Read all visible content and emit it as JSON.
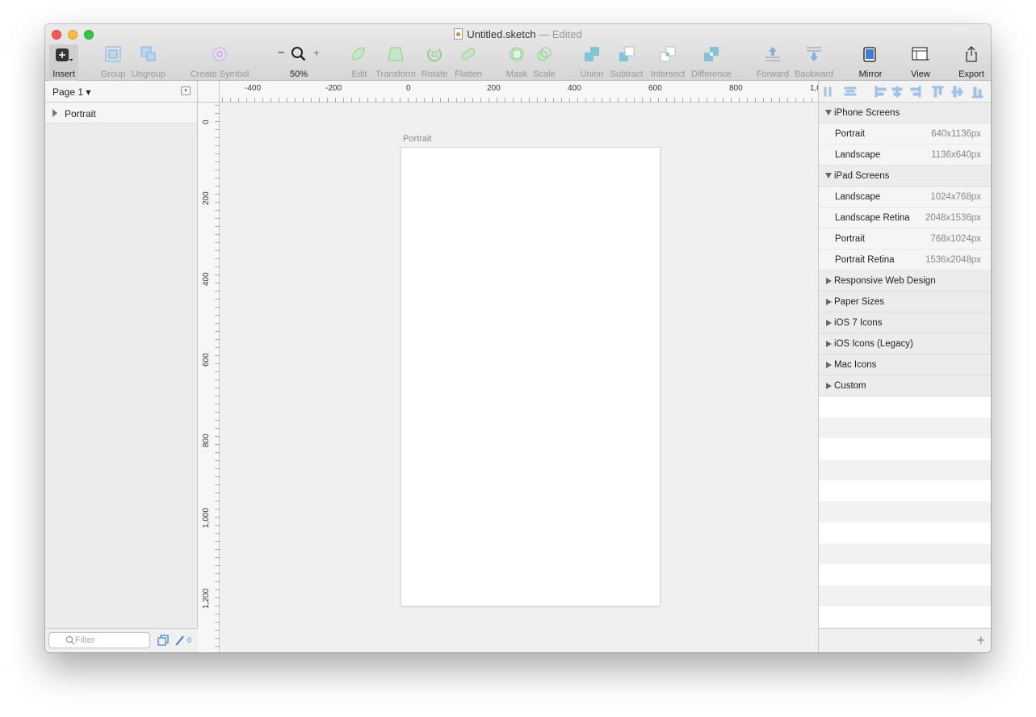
{
  "window": {
    "title": "Untitled.sketch",
    "status": "— Edited"
  },
  "toolbar": [
    {
      "name": "insert-button",
      "label": "Insert",
      "icon": "insert-plus-icon"
    },
    {
      "name": "group-button",
      "label": "Group",
      "icon": "group-icon"
    },
    {
      "name": "ungroup-button",
      "label": "Ungroup",
      "icon": "ungroup-icon"
    },
    {
      "name": "create-symbol-button",
      "label": "Create Symbol",
      "icon": "symbol-icon"
    },
    {
      "name": "zoom-control",
      "label": "50%",
      "icon": "magnifier-icon"
    },
    {
      "name": "edit-button",
      "label": "Edit",
      "icon": "edit-icon"
    },
    {
      "name": "transform-button",
      "label": "Transform",
      "icon": "transform-icon"
    },
    {
      "name": "rotate-button",
      "label": "Rotate",
      "icon": "rotate-icon"
    },
    {
      "name": "flatten-button",
      "label": "Flatten",
      "icon": "flatten-icon"
    },
    {
      "name": "mask-button",
      "label": "Mask",
      "icon": "mask-icon"
    },
    {
      "name": "scale-button",
      "label": "Scale",
      "icon": "scale-icon"
    },
    {
      "name": "union-button",
      "label": "Union",
      "icon": "union-icon"
    },
    {
      "name": "subtract-button",
      "label": "Subtract",
      "icon": "subtract-icon"
    },
    {
      "name": "intersect-button",
      "label": "Intersect",
      "icon": "intersect-icon"
    },
    {
      "name": "difference-button",
      "label": "Difference",
      "icon": "difference-icon"
    },
    {
      "name": "forward-button",
      "label": "Forward",
      "icon": "forward-icon"
    },
    {
      "name": "backward-button",
      "label": "Backward",
      "icon": "backward-icon"
    },
    {
      "name": "mirror-button",
      "label": "Mirror",
      "icon": "mirror-icon"
    },
    {
      "name": "view-button",
      "label": "View",
      "icon": "view-icon"
    },
    {
      "name": "export-button",
      "label": "Export",
      "icon": "export-icon"
    }
  ],
  "zoom": {
    "minus": "−",
    "plus": "+"
  },
  "sidebar": {
    "page_label": "Page 1 ▾",
    "layers": [
      {
        "label": "Portrait"
      }
    ],
    "filter_placeholder": "Filter",
    "count": "0"
  },
  "rulers": {
    "horizontal": [
      "-400",
      "-200",
      "0",
      "200",
      "400",
      "600",
      "800",
      "1,0"
    ],
    "vertical": [
      "0",
      "200",
      "400",
      "600",
      "800",
      "1,000",
      "1,200"
    ]
  },
  "canvas": {
    "artboard_label": "Portrait"
  },
  "presets": [
    {
      "section": "iPhone Screens",
      "open": true,
      "items": [
        {
          "name": "Portrait",
          "size": "640x1136px"
        },
        {
          "name": "Landscape",
          "size": "1136x640px"
        }
      ]
    },
    {
      "section": "iPad Screens",
      "open": true,
      "items": [
        {
          "name": "Landscape",
          "size": "1024x768px"
        },
        {
          "name": "Landscape Retina",
          "size": "2048x1536px"
        },
        {
          "name": "Portrait",
          "size": "768x1024px"
        },
        {
          "name": "Portrait Retina",
          "size": "1536x2048px"
        }
      ]
    },
    {
      "section": "Responsive Web Design",
      "open": false,
      "items": []
    },
    {
      "section": "Paper Sizes",
      "open": false,
      "items": []
    },
    {
      "section": "iOS 7 Icons",
      "open": false,
      "items": []
    },
    {
      "section": "iOS Icons (Legacy)",
      "open": false,
      "items": []
    },
    {
      "section": "Mac Icons",
      "open": false,
      "items": []
    },
    {
      "section": "Custom",
      "open": false,
      "items": []
    }
  ],
  "colors": {
    "close": "#fc5753",
    "minimize": "#fdbc40",
    "zoom": "#33c748",
    "accent": "#4a90d9",
    "disabled_green": "#8fd08f",
    "disabled_blue": "#7fb3df"
  }
}
